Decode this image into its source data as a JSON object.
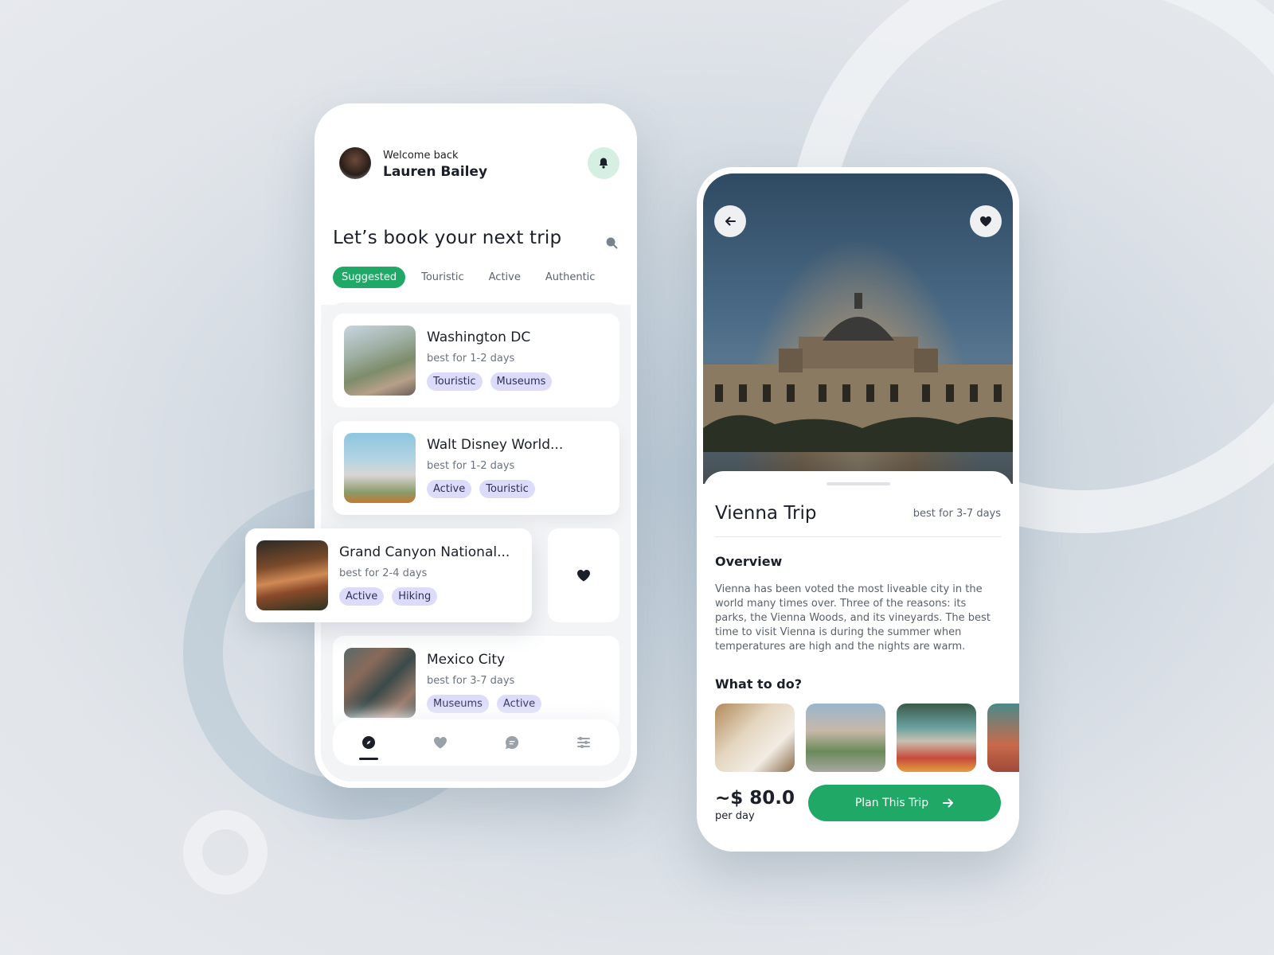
{
  "home": {
    "welcome": "Welcome back",
    "user_name": "Lauren Bailey",
    "heading": "Let’s book your next trip",
    "filters": [
      "Suggested",
      "Touristic",
      "Active",
      "Authentic"
    ],
    "active_filter": "Suggested",
    "trips": [
      {
        "name": "Washington DC",
        "duration": "best for 1-2 days",
        "tags": [
          "Touristic",
          "Museums"
        ]
      },
      {
        "name": "Walt Disney World...",
        "duration": "best for 1-2 days",
        "tags": [
          "Active",
          "Touristic"
        ]
      },
      {
        "name": "Grand Canyon National...",
        "duration": "best for 2-4 days",
        "tags": [
          "Active",
          "Hiking"
        ]
      },
      {
        "name": "Mexico City",
        "duration": "best for 3-7 days",
        "tags": [
          "Museums",
          "Active"
        ]
      }
    ],
    "nav": [
      "explore-icon",
      "heart-icon",
      "chat-icon",
      "sliders-icon"
    ]
  },
  "detail": {
    "title": "Vienna Trip",
    "duration": "best for 3-7 days",
    "overview_heading": "Overview",
    "overview_text": "Vienna has been voted the most liveable city in the world many times over. Three of the reasons: its parks, the Vienna Woods, and its vineyards. The best time to visit Vienna is during the summer when temperatures are high and the nights are warm.",
    "todo_heading": "What to do?",
    "price": "~$ 80.0",
    "price_unit": "per day",
    "cta": "Plan This Trip"
  },
  "colors": {
    "accent": "#1fa866",
    "tag_bg": "#dcdcfa",
    "bell_bg": "#d6efe3"
  }
}
